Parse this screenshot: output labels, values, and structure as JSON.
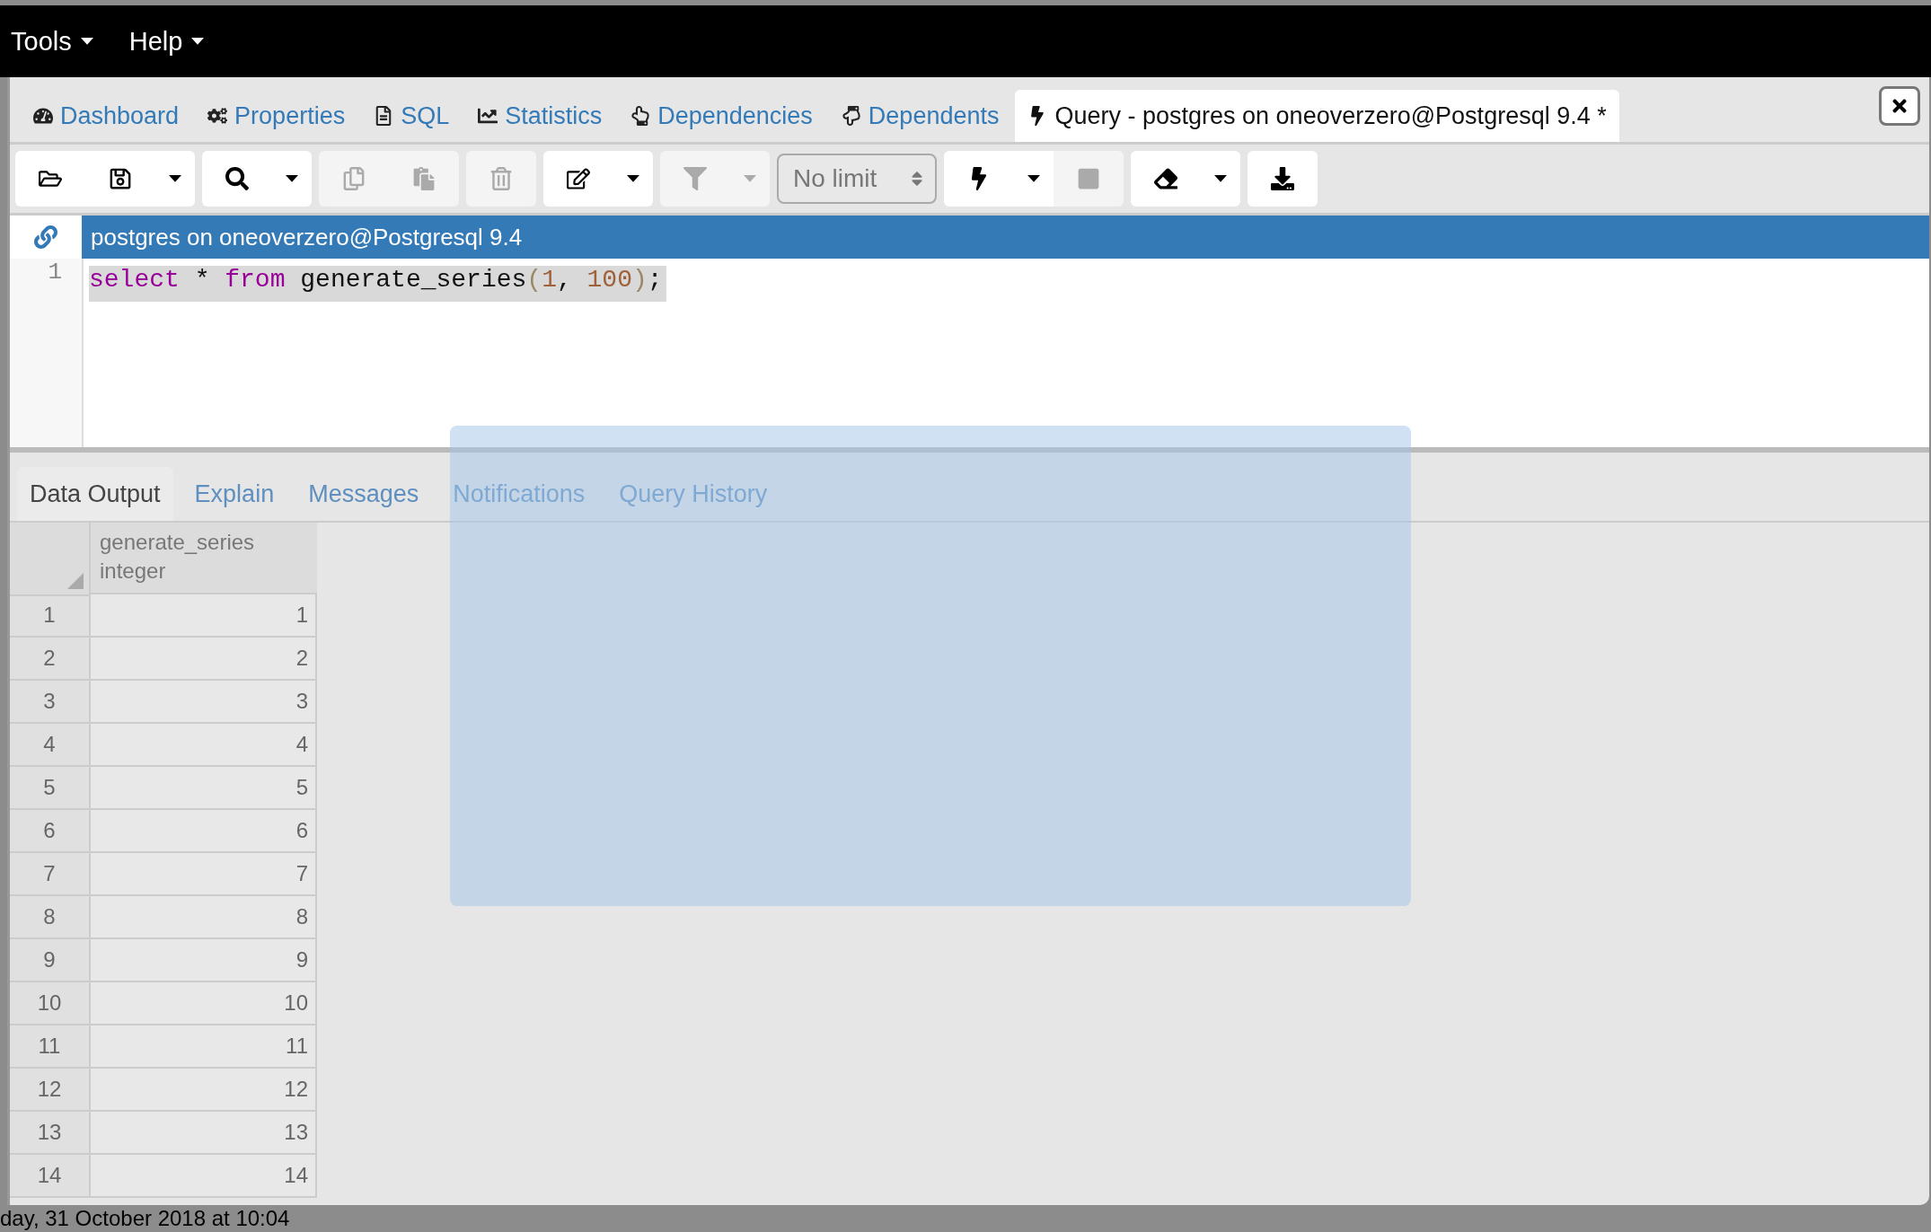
{
  "menubar": [
    {
      "label": "Tools"
    },
    {
      "label": "Help"
    }
  ],
  "panel_tabs": [
    {
      "label": "Dashboard",
      "kind": "dashboard",
      "selected": false
    },
    {
      "label": "Properties",
      "kind": "properties",
      "selected": false
    },
    {
      "label": "SQL",
      "kind": "sql",
      "selected": false
    },
    {
      "label": "Statistics",
      "kind": "statistics",
      "selected": false
    },
    {
      "label": "Dependencies",
      "kind": "dependencies",
      "selected": false
    },
    {
      "label": "Dependents",
      "kind": "dependents",
      "selected": false
    },
    {
      "label": "Query - postgres on oneoverzero@Postgresql 9.4 *",
      "kind": "query",
      "selected": true
    }
  ],
  "toolbar": [
    [
      {
        "kind": "open",
        "disabled": false
      },
      {
        "kind": "save",
        "disabled": false
      },
      {
        "kind": "caret",
        "disabled": false
      }
    ],
    [
      {
        "kind": "search",
        "disabled": false
      },
      {
        "kind": "caret",
        "disabled": false
      }
    ],
    [
      {
        "kind": "copy",
        "disabled": true
      },
      {
        "kind": "paste",
        "disabled": true
      }
    ],
    [
      {
        "kind": "delete",
        "disabled": true
      }
    ],
    [
      {
        "kind": "edit",
        "disabled": false
      },
      {
        "kind": "caret",
        "disabled": false
      }
    ],
    [
      {
        "kind": "filter",
        "disabled": true
      },
      {
        "kind": "caret",
        "disabled": true
      }
    ],
    [
      {
        "kind": "limit",
        "value": "No limit",
        "disabled": true
      }
    ],
    [
      {
        "kind": "execute",
        "disabled": false
      },
      {
        "kind": "caret",
        "disabled": false
      },
      {
        "kind": "stop",
        "disabled": true
      }
    ],
    [
      {
        "kind": "clear",
        "disabled": false
      },
      {
        "kind": "caret",
        "disabled": false
      }
    ],
    [
      {
        "kind": "download",
        "disabled": false
      }
    ]
  ],
  "connection": {
    "label": "postgres on oneoverzero@Postgresql 9.4"
  },
  "editor": {
    "lines": [
      {
        "number": "1",
        "tokens": [
          {
            "kind": "keyword",
            "text": "select"
          },
          {
            "kind": "plain",
            "text": " * "
          },
          {
            "kind": "keyword",
            "text": "from"
          },
          {
            "kind": "plain",
            "text": " generate_series"
          },
          {
            "kind": "paren",
            "text": "("
          },
          {
            "kind": "number",
            "text": "1"
          },
          {
            "kind": "plain",
            "text": ", "
          },
          {
            "kind": "number",
            "text": "100"
          },
          {
            "kind": "paren",
            "text": ")"
          },
          {
            "kind": "plain",
            "text": ";"
          }
        ]
      }
    ]
  },
  "result_tabs": [
    {
      "label": "Data Output",
      "selected": true
    },
    {
      "label": "Explain",
      "selected": false
    },
    {
      "label": "Messages",
      "selected": false
    },
    {
      "label": "Notifications",
      "selected": false
    },
    {
      "label": "Query History",
      "selected": false
    }
  ],
  "grid": {
    "columns": [
      {
        "name": "generate_series",
        "type": "integer"
      }
    ],
    "rows": [
      {
        "number": "1",
        "cells": [
          "1"
        ]
      },
      {
        "number": "2",
        "cells": [
          "2"
        ]
      },
      {
        "number": "3",
        "cells": [
          "3"
        ]
      },
      {
        "number": "4",
        "cells": [
          "4"
        ]
      },
      {
        "number": "5",
        "cells": [
          "5"
        ]
      },
      {
        "number": "6",
        "cells": [
          "6"
        ]
      },
      {
        "number": "7",
        "cells": [
          "7"
        ]
      },
      {
        "number": "8",
        "cells": [
          "8"
        ]
      },
      {
        "number": "9",
        "cells": [
          "9"
        ]
      },
      {
        "number": "10",
        "cells": [
          "10"
        ]
      },
      {
        "number": "11",
        "cells": [
          "11"
        ]
      },
      {
        "number": "12",
        "cells": [
          "12"
        ]
      },
      {
        "number": "13",
        "cells": [
          "13"
        ]
      },
      {
        "number": "14",
        "cells": [
          "14"
        ]
      }
    ]
  },
  "background_text": "day, 31 October 2018 at 10:04"
}
